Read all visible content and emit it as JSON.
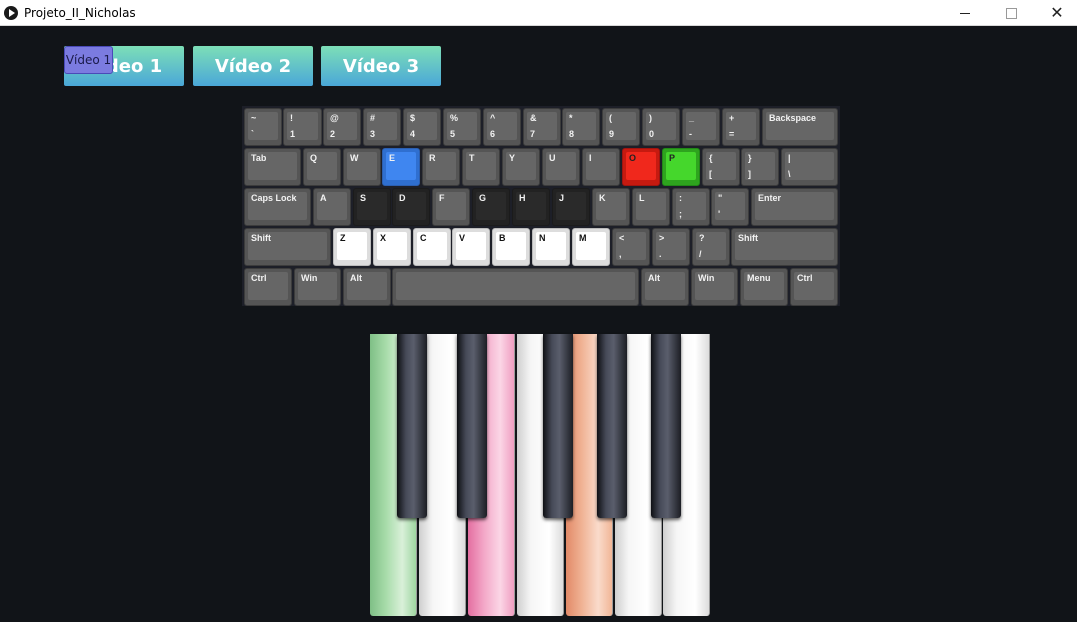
{
  "window": {
    "title": "Projeto_II_Nicholas"
  },
  "video_buttons": [
    {
      "label": "Vídeo 1"
    },
    {
      "label": "Vídeo 2"
    },
    {
      "label": "Vídeo 3"
    }
  ],
  "tooltip": {
    "text": "Vídeo 1"
  },
  "colors": {
    "pressed_blue": "#3f86f0",
    "pressed_red": "#f0281c",
    "pressed_green": "#45d72c"
  },
  "keyboard": {
    "row1": [
      {
        "top": "~",
        "bottom": "`"
      },
      {
        "top": "!",
        "bottom": "1"
      },
      {
        "top": "@",
        "bottom": "2"
      },
      {
        "top": "#",
        "bottom": "3"
      },
      {
        "top": "$",
        "bottom": "4"
      },
      {
        "top": "%",
        "bottom": "5"
      },
      {
        "top": "^",
        "bottom": "6"
      },
      {
        "top": "&",
        "bottom": "7"
      },
      {
        "top": "*",
        "bottom": "8"
      },
      {
        "top": "(",
        "bottom": "9"
      },
      {
        "top": ")",
        "bottom": "0"
      },
      {
        "top": "_",
        "bottom": "-"
      },
      {
        "top": "+",
        "bottom": "="
      },
      {
        "top": "Backspace",
        "bottom": ""
      }
    ],
    "row2": [
      {
        "top": "Tab",
        "bottom": ""
      },
      {
        "top": "Q",
        "bottom": ""
      },
      {
        "top": "W",
        "bottom": ""
      },
      {
        "top": "E",
        "bottom": ""
      },
      {
        "top": "R",
        "bottom": ""
      },
      {
        "top": "T",
        "bottom": ""
      },
      {
        "top": "Y",
        "bottom": ""
      },
      {
        "top": "U",
        "bottom": ""
      },
      {
        "top": "I",
        "bottom": ""
      },
      {
        "top": "O",
        "bottom": ""
      },
      {
        "top": "P",
        "bottom": ""
      },
      {
        "top": "{",
        "bottom": "["
      },
      {
        "top": "}",
        "bottom": "]"
      },
      {
        "top": "|",
        "bottom": "\\"
      }
    ],
    "row3": [
      {
        "top": "Caps Lock",
        "bottom": ""
      },
      {
        "top": "A",
        "bottom": ""
      },
      {
        "top": "S",
        "bottom": ""
      },
      {
        "top": "D",
        "bottom": ""
      },
      {
        "top": "F",
        "bottom": ""
      },
      {
        "top": "G",
        "bottom": ""
      },
      {
        "top": "H",
        "bottom": ""
      },
      {
        "top": "J",
        "bottom": ""
      },
      {
        "top": "K",
        "bottom": ""
      },
      {
        "top": "L",
        "bottom": ""
      },
      {
        "top": ":",
        "bottom": ";"
      },
      {
        "top": "\"",
        "bottom": "'"
      },
      {
        "top": "Enter",
        "bottom": ""
      }
    ],
    "row4": [
      {
        "top": "Shift",
        "bottom": ""
      },
      {
        "top": "Z",
        "bottom": ""
      },
      {
        "top": "X",
        "bottom": ""
      },
      {
        "top": "C",
        "bottom": ""
      },
      {
        "top": "V",
        "bottom": ""
      },
      {
        "top": "B",
        "bottom": ""
      },
      {
        "top": "N",
        "bottom": ""
      },
      {
        "top": "M",
        "bottom": ""
      },
      {
        "top": "<",
        "bottom": ","
      },
      {
        "top": ">",
        "bottom": "."
      },
      {
        "top": "?",
        "bottom": "/"
      },
      {
        "top": "Shift",
        "bottom": ""
      }
    ],
    "row5": [
      {
        "top": "Ctrl",
        "bottom": ""
      },
      {
        "top": "Win",
        "bottom": ""
      },
      {
        "top": "Alt",
        "bottom": ""
      },
      {
        "top": "",
        "bottom": ""
      },
      {
        "top": "Alt",
        "bottom": ""
      },
      {
        "top": "Win",
        "bottom": ""
      },
      {
        "top": "Menu",
        "bottom": ""
      },
      {
        "top": "Ctrl",
        "bottom": ""
      }
    ]
  }
}
